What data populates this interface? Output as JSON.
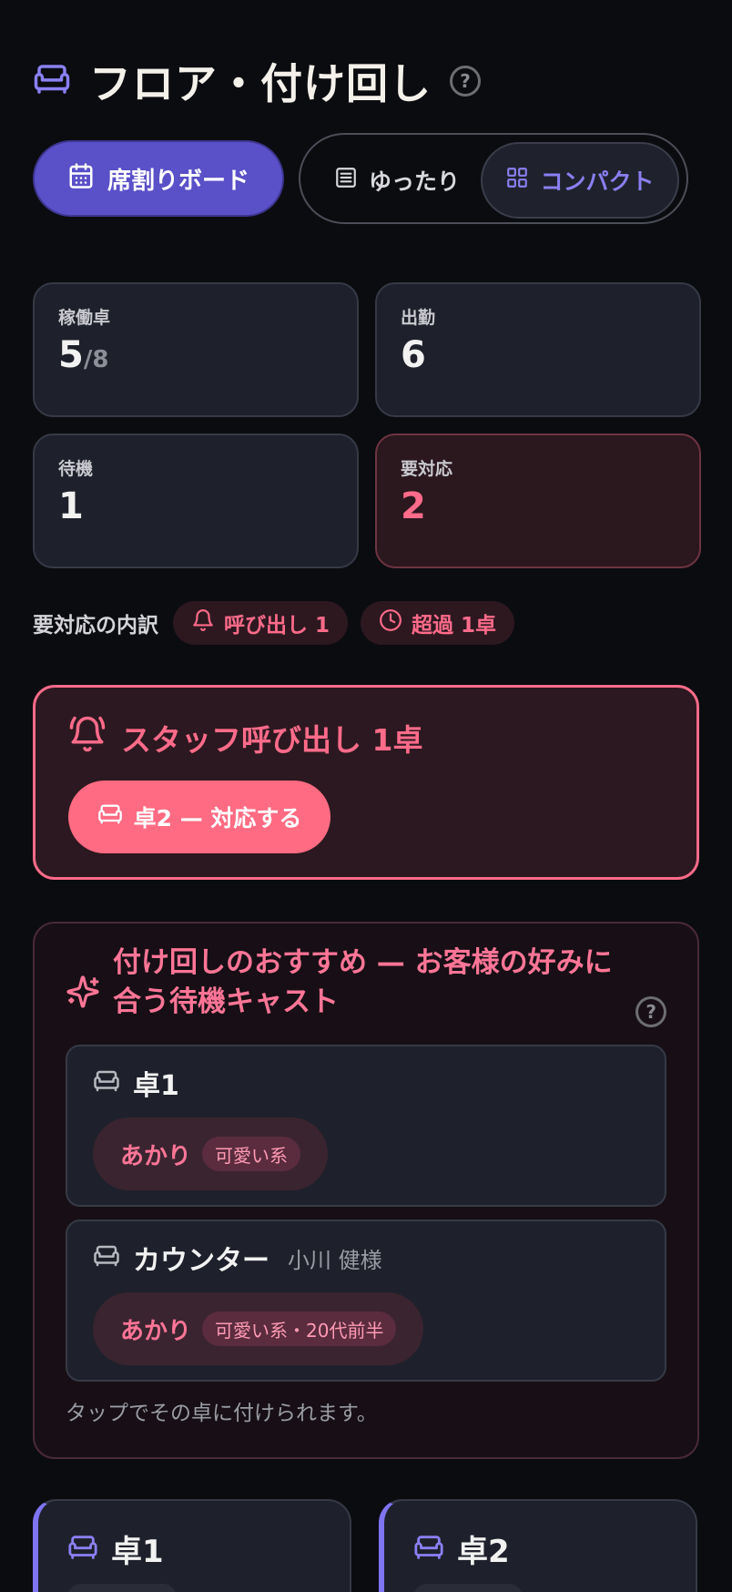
{
  "header": {
    "title": "フロア・付け回し",
    "icon": "sofa-icon"
  },
  "modes": {
    "board_label": "席割りボード",
    "spacious_label": "ゆったり",
    "compact_label": "コンパクト",
    "selected": "コンパクト"
  },
  "stats": {
    "active_tables": {
      "label": "稼働卓",
      "value": "5",
      "total": "/8"
    },
    "attendance": {
      "label": "出勤",
      "value": "6"
    },
    "standby": {
      "label": "待機",
      "value": "1"
    },
    "needs_action": {
      "label": "要対応",
      "value": "2"
    }
  },
  "breakdown": {
    "label": "要対応の内訳",
    "call_chip": "呼び出し 1",
    "overtime_chip": "超過 1卓"
  },
  "call_card": {
    "title": "スタッフ呼び出し 1卓",
    "button_label": "卓2 — 対応する"
  },
  "recommendation": {
    "title": "付け回しのおすすめ — お客様の好みに合う待機キャスト",
    "items": [
      {
        "table": "卓1",
        "guest": "",
        "cast": "あかり",
        "tag": "可愛い系"
      },
      {
        "table": "カウンター",
        "guest": "小川 健様",
        "cast": "あかり",
        "tag": "可愛い系・20代前半"
      }
    ],
    "hint": "タップでその卓に付けられます。"
  },
  "tables": [
    {
      "name": "卓1"
    },
    {
      "name": "卓2"
    }
  ],
  "colors": {
    "accent": "#5a50c8",
    "alert": "#ff6b8a",
    "background": "#0b0c10",
    "card": "#1e212b"
  }
}
